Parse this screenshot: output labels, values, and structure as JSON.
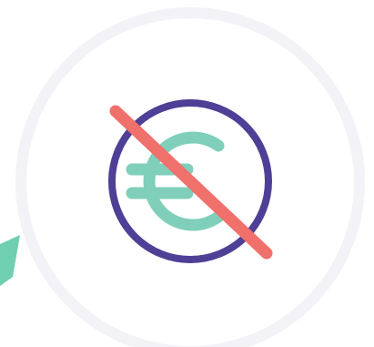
{
  "illustration": {
    "icon": "no-euro-icon",
    "colors": {
      "background": "#ffffff",
      "outer_ring": "#f2f2f7",
      "coin_ring": "#4f3f96",
      "euro_symbol": "#7fcfba",
      "strike_line": "#f0706c",
      "corner_shape": "#6fcfb0"
    }
  }
}
